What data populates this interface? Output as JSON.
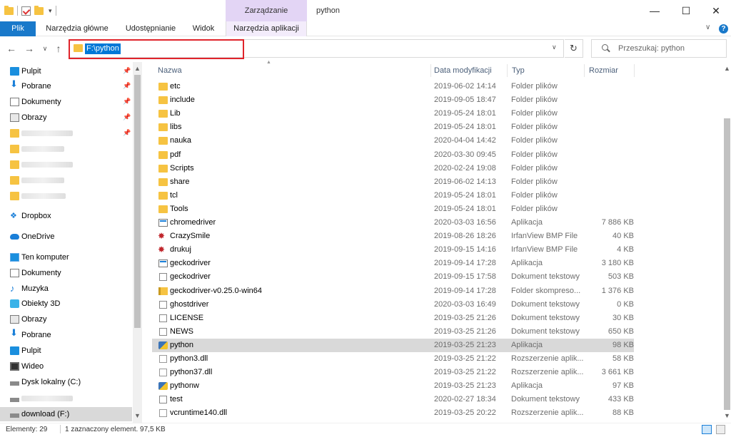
{
  "titlebar": {
    "context_group": "Zarządzanie",
    "window_title": "python",
    "controls": {
      "minimize": "—",
      "maximize": "☐",
      "close": "✕"
    }
  },
  "ribbon": {
    "tabs": [
      "Plik",
      "Narzędzia główne",
      "Udostępnianie",
      "Widok",
      "Narzędzia aplikacji"
    ],
    "help": "?",
    "collapse": "∨"
  },
  "nav": {
    "back": "←",
    "forward": "→",
    "recent": "∨",
    "up": "↑",
    "address": "F:\\python",
    "address_dropdown": "∨",
    "refresh": "↻",
    "search_placeholder": "Przeszukaj: python"
  },
  "sidebar": {
    "quick_access": [
      {
        "label": "Pulpit",
        "icon": "desktop-icon",
        "pinned": true
      },
      {
        "label": "Pobrane",
        "icon": "download-icon",
        "pinned": true
      },
      {
        "label": "Dokumenty",
        "icon": "document-icon",
        "pinned": true
      },
      {
        "label": "Obrazy",
        "icon": "pictures-icon",
        "pinned": true
      }
    ],
    "dropbox": "Dropbox",
    "onedrive": "OneDrive",
    "this_pc": "Ten komputer",
    "pc_items": [
      {
        "label": "Dokumenty",
        "icon": "document-icon"
      },
      {
        "label": "Muzyka",
        "icon": "music-icon"
      },
      {
        "label": "Obiekty 3D",
        "icon": "3d-objects-icon"
      },
      {
        "label": "Obrazy",
        "icon": "pictures-icon"
      },
      {
        "label": "Pobrane",
        "icon": "download-icon"
      },
      {
        "label": "Pulpit",
        "icon": "desktop-icon"
      },
      {
        "label": "Wideo",
        "icon": "video-icon"
      },
      {
        "label": "Dysk lokalny (C:)",
        "icon": "drive-icon"
      }
    ],
    "selected_drive": "download (F:)"
  },
  "columns": {
    "name": "Nazwa",
    "date": "Data modyfikacji",
    "type": "Typ",
    "size": "Rozmiar"
  },
  "files": [
    {
      "name": "etc",
      "date": "2019-06-02 14:14",
      "type": "Folder plików",
      "size": "",
      "icon": "folder"
    },
    {
      "name": "include",
      "date": "2019-09-05 18:47",
      "type": "Folder plików",
      "size": "",
      "icon": "folder"
    },
    {
      "name": "Lib",
      "date": "2019-05-24 18:01",
      "type": "Folder plików",
      "size": "",
      "icon": "folder"
    },
    {
      "name": "libs",
      "date": "2019-05-24 18:01",
      "type": "Folder plików",
      "size": "",
      "icon": "folder"
    },
    {
      "name": "nauka",
      "date": "2020-04-04 14:42",
      "type": "Folder plików",
      "size": "",
      "icon": "folder"
    },
    {
      "name": "pdf",
      "date": "2020-03-30 09:45",
      "type": "Folder plików",
      "size": "",
      "icon": "folder"
    },
    {
      "name": "Scripts",
      "date": "2020-02-24 19:08",
      "type": "Folder plików",
      "size": "",
      "icon": "folder"
    },
    {
      "name": "share",
      "date": "2019-06-02 14:13",
      "type": "Folder plików",
      "size": "",
      "icon": "folder"
    },
    {
      "name": "tcl",
      "date": "2019-05-24 18:01",
      "type": "Folder plików",
      "size": "",
      "icon": "folder"
    },
    {
      "name": "Tools",
      "date": "2019-05-24 18:01",
      "type": "Folder plików",
      "size": "",
      "icon": "folder"
    },
    {
      "name": "chromedriver",
      "date": "2020-03-03 16:56",
      "type": "Aplikacja",
      "size": "7 886 KB",
      "icon": "app"
    },
    {
      "name": "CrazySmile",
      "date": "2019-08-26 18:26",
      "type": "IrfanView BMP File",
      "size": "40 KB",
      "icon": "bmp"
    },
    {
      "name": "drukuj",
      "date": "2019-09-15 14:16",
      "type": "IrfanView BMP File",
      "size": "4 KB",
      "icon": "bmp"
    },
    {
      "name": "geckodriver",
      "date": "2019-09-14 17:28",
      "type": "Aplikacja",
      "size": "3 180 KB",
      "icon": "app"
    },
    {
      "name": "geckodriver",
      "date": "2019-09-15 17:58",
      "type": "Dokument tekstowy",
      "size": "503 KB",
      "icon": "txt"
    },
    {
      "name": "geckodriver-v0.25.0-win64",
      "date": "2019-09-14 17:28",
      "type": "Folder skompreso...",
      "size": "1 376 KB",
      "icon": "zip"
    },
    {
      "name": "ghostdriver",
      "date": "2020-03-03 16:49",
      "type": "Dokument tekstowy",
      "size": "0 KB",
      "icon": "txt"
    },
    {
      "name": "LICENSE",
      "date": "2019-03-25 21:26",
      "type": "Dokument tekstowy",
      "size": "30 KB",
      "icon": "txt"
    },
    {
      "name": "NEWS",
      "date": "2019-03-25 21:26",
      "type": "Dokument tekstowy",
      "size": "650 KB",
      "icon": "txt"
    },
    {
      "name": "python",
      "date": "2019-03-25 21:23",
      "type": "Aplikacja",
      "size": "98 KB",
      "icon": "py",
      "selected": true
    },
    {
      "name": "python3.dll",
      "date": "2019-03-25 21:22",
      "type": "Rozszerzenie aplik...",
      "size": "58 KB",
      "icon": "dll"
    },
    {
      "name": "python37.dll",
      "date": "2019-03-25 21:22",
      "type": "Rozszerzenie aplik...",
      "size": "3 661 KB",
      "icon": "dll"
    },
    {
      "name": "pythonw",
      "date": "2019-03-25 21:23",
      "type": "Aplikacja",
      "size": "97 KB",
      "icon": "py"
    },
    {
      "name": "test",
      "date": "2020-02-27 18:34",
      "type": "Dokument tekstowy",
      "size": "433 KB",
      "icon": "txt"
    },
    {
      "name": "vcruntime140.dll",
      "date": "2019-03-25 20:22",
      "type": "Rozszerzenie aplik...",
      "size": "88 KB",
      "icon": "dll"
    }
  ],
  "status": {
    "items": "Elementy: 29",
    "selection": "1 zaznaczony element. 97,5 KB"
  },
  "colors": {
    "accent": "#0078d7",
    "file_tab": "#1979ca",
    "context_tab": "#e3d5f5",
    "highlight": "#e0242b",
    "selected_row": "#d9d9d9"
  }
}
